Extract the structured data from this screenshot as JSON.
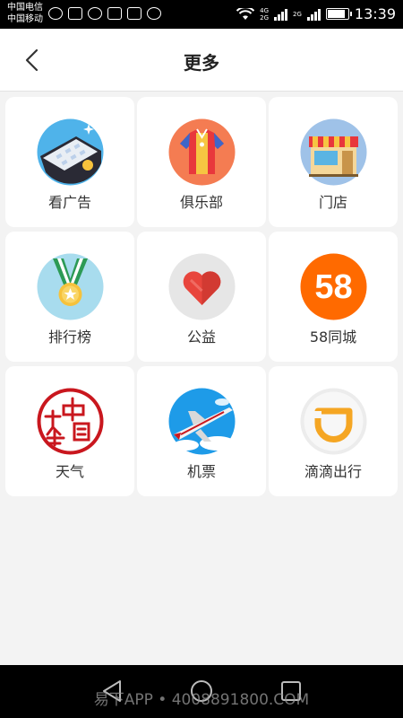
{
  "status_bar": {
    "carrier1": "中国电信",
    "carrier2": "中国移动",
    "net1": "4G",
    "net2": "2G",
    "net3": "2G",
    "time": "13:39"
  },
  "header": {
    "title": "更多"
  },
  "tiles": [
    {
      "label": "看广告",
      "icon": "ads-phone-icon"
    },
    {
      "label": "俱乐部",
      "icon": "club-jersey-icon"
    },
    {
      "label": "门店",
      "icon": "store-icon"
    },
    {
      "label": "排行榜",
      "icon": "medal-icon"
    },
    {
      "label": "公益",
      "icon": "heart-icon"
    },
    {
      "label": "58同城",
      "icon": "58-icon",
      "badge": "58"
    },
    {
      "label": "天气",
      "icon": "weather-seal-icon"
    },
    {
      "label": "机票",
      "icon": "airplane-icon"
    },
    {
      "label": "滴滴出行",
      "icon": "didi-icon"
    }
  ],
  "watermark": "易下APP • 4008891800.COM",
  "colors": {
    "accent_orange": "#ff6a00",
    "heart_red": "#e8453c",
    "sky_blue": "#1e9be8",
    "seal_red": "#c9171e"
  }
}
